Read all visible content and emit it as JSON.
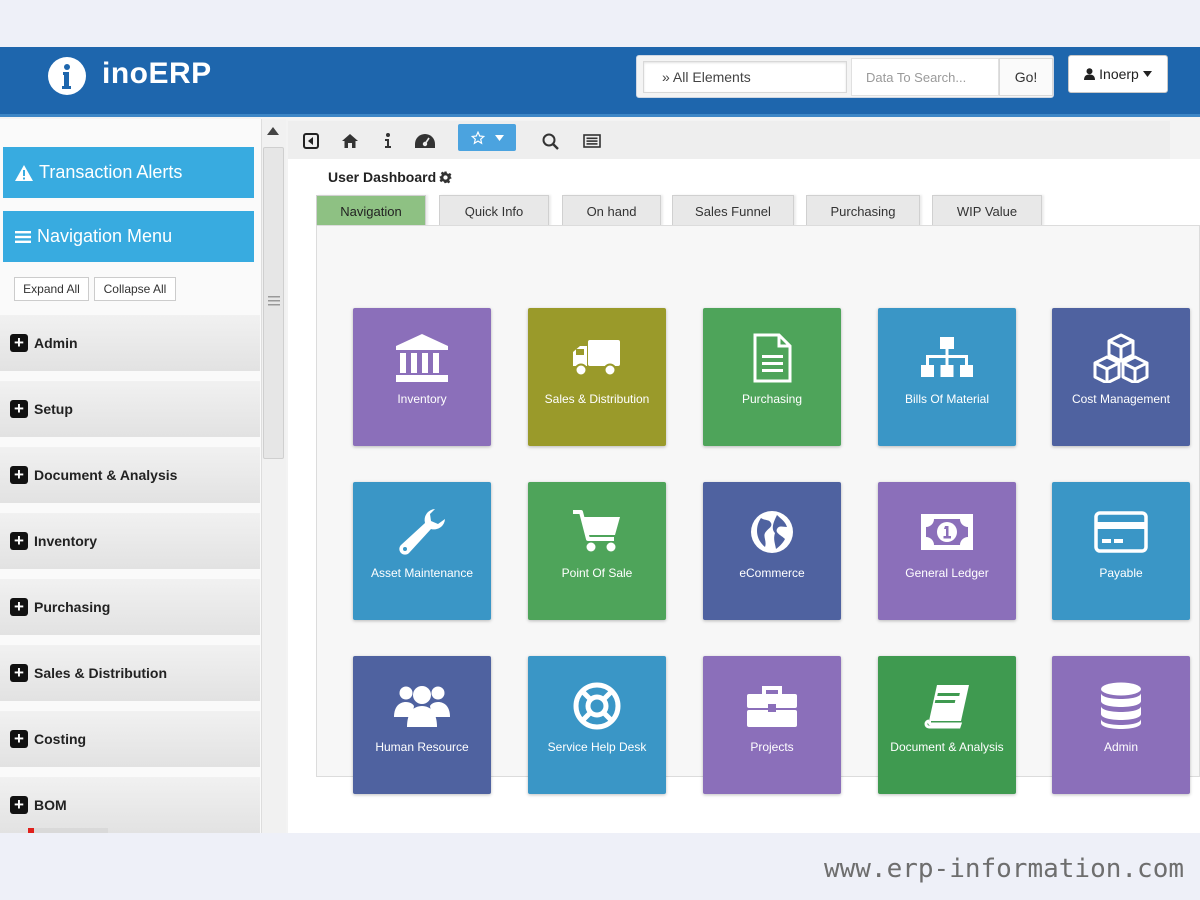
{
  "app": {
    "brand": "inoERP"
  },
  "header": {
    "search_scope": "All Elements",
    "search_placeholder": "Data To Search...",
    "go_label": "Go!",
    "user_label": "Inoerp"
  },
  "sidebar": {
    "alerts_label": "Transaction Alerts",
    "nav_label": "Navigation Menu",
    "expand_label": "Expand All",
    "collapse_label": "Collapse All",
    "items": [
      {
        "label": "Admin"
      },
      {
        "label": "Setup"
      },
      {
        "label": "Document & Analysis"
      },
      {
        "label": "Inventory"
      },
      {
        "label": "Purchasing"
      },
      {
        "label": "Sales & Distribution"
      },
      {
        "label": "Costing"
      },
      {
        "label": "BOM"
      }
    ]
  },
  "toolbar": {
    "icons": [
      "back-icon",
      "home-icon",
      "info-icon",
      "dashboard-icon",
      "favorite-star-icon",
      "search-icon",
      "list-icon"
    ]
  },
  "dashboard": {
    "title": "User Dashboard",
    "tabs": [
      {
        "label": "Navigation"
      },
      {
        "label": "Quick Info"
      },
      {
        "label": "On hand"
      },
      {
        "label": "Sales Funnel"
      },
      {
        "label": "Purchasing"
      },
      {
        "label": "WIP Value"
      }
    ],
    "tiles": [
      {
        "label": "Inventory",
        "icon": "bank-icon",
        "color": "#8b6fba"
      },
      {
        "label": "Sales & Distribution",
        "icon": "truck-icon",
        "color": "#9a9a2a"
      },
      {
        "label": "Purchasing",
        "icon": "document-icon",
        "color": "#4ea45a"
      },
      {
        "label": "Bills Of Material",
        "icon": "sitemap-icon",
        "color": "#3a96c6"
      },
      {
        "label": "Cost Management",
        "icon": "cubes-icon",
        "color": "#4f62a0"
      },
      {
        "label": "Asset Maintenance",
        "icon": "wrench-icon",
        "color": "#3a96c6"
      },
      {
        "label": "Point Of Sale",
        "icon": "cart-icon",
        "color": "#4ea45a"
      },
      {
        "label": "eCommerce",
        "icon": "globe-icon",
        "color": "#4f62a0"
      },
      {
        "label": "General Ledger",
        "icon": "money-icon",
        "color": "#8b6fba"
      },
      {
        "label": "Payable",
        "icon": "credit-card-icon",
        "color": "#3a96c6"
      },
      {
        "label": "Human Resource",
        "icon": "users-icon",
        "color": "#4f62a0"
      },
      {
        "label": "Service Help Desk",
        "icon": "lifebuoy-icon",
        "color": "#3a96c6"
      },
      {
        "label": "Projects",
        "icon": "briefcase-icon",
        "color": "#8b6fba"
      },
      {
        "label": "Document & Analysis",
        "icon": "book-icon",
        "color": "#3f9a50"
      },
      {
        "label": "Admin",
        "icon": "database-icon",
        "color": "#8b6fba"
      }
    ]
  },
  "watermark": "www.erp-information.com"
}
